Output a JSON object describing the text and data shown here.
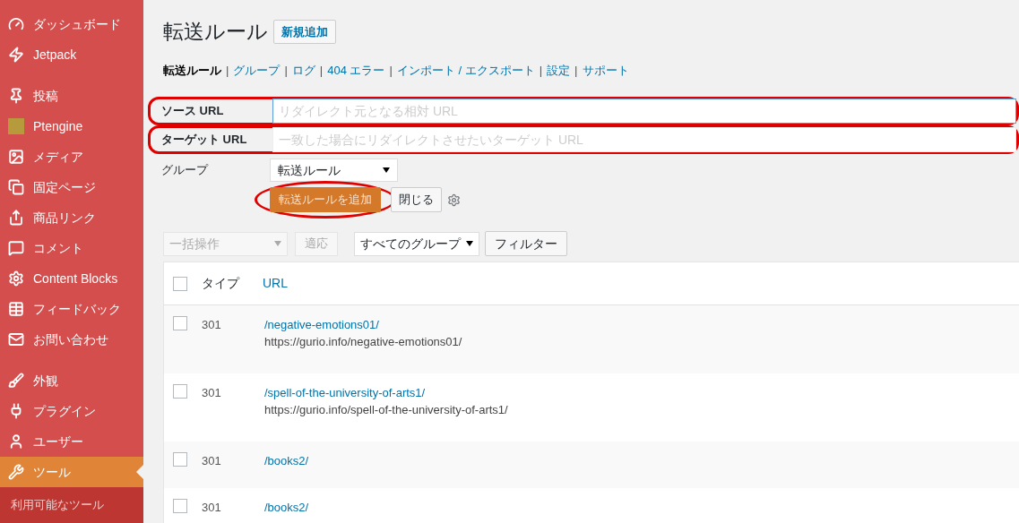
{
  "sidebar": {
    "groups": [
      [
        {
          "label": "ダッシュボード",
          "selected": false
        },
        {
          "label": "Jetpack",
          "selected": false
        }
      ],
      [
        {
          "label": "投稿",
          "selected": false
        },
        {
          "label": "Ptengine",
          "selected": false
        },
        {
          "label": "メディア",
          "selected": false
        },
        {
          "label": "固定ページ",
          "selected": false
        },
        {
          "label": "商品リンク",
          "selected": false
        },
        {
          "label": "コメント",
          "selected": false
        },
        {
          "label": "Content Blocks",
          "selected": false
        },
        {
          "label": "フィードバック",
          "selected": false
        },
        {
          "label": "お問い合わせ",
          "selected": false
        }
      ],
      [
        {
          "label": "外観",
          "selected": false
        },
        {
          "label": "プラグイン",
          "selected": false
        },
        {
          "label": "ユーザー",
          "selected": false
        },
        {
          "label": "ツール",
          "selected": true
        }
      ]
    ],
    "submenu": [
      {
        "label": "利用可能なツール",
        "selected": false
      }
    ]
  },
  "page": {
    "title": "転送ルール",
    "add_new": "新規追加"
  },
  "subnav": [
    {
      "label": "転送ルール",
      "selected": true
    },
    {
      "label": "グループ",
      "selected": false
    },
    {
      "label": "ログ",
      "selected": false
    },
    {
      "label": "404 エラー",
      "selected": false
    },
    {
      "label": "インポート / エクスポート",
      "selected": false
    },
    {
      "label": "設定",
      "selected": false
    },
    {
      "label": "サポート",
      "selected": false
    }
  ],
  "subnav_separator": "|",
  "form": {
    "fields": [
      {
        "label": "ソース URL",
        "placeholder": "リダイレクト元となる相対 URL",
        "highlighted": true
      },
      {
        "label": "ターゲット URL",
        "placeholder": "一致した場合にリダイレクトさせたいターゲット URL",
        "highlighted": true
      }
    ],
    "group": {
      "label": "グループ",
      "value": "転送ルール"
    },
    "submit": {
      "label": "転送ルールを追加",
      "highlighted": true
    },
    "close": "閉じる"
  },
  "toolbar": {
    "bulk": {
      "value": "一括操作",
      "disabled": true
    },
    "apply": {
      "label": "適応",
      "disabled": true
    },
    "group_filter": "すべてのグループ",
    "filter": "フィルター"
  },
  "table": {
    "select_all": false,
    "columns": [
      "タイプ",
      "URL"
    ],
    "rows": [
      {
        "checked": false,
        "type": "301",
        "source": "/negative-emotions01/",
        "target": "https://gurio.info/negative-emotions01/"
      },
      {
        "checked": false,
        "type": "301",
        "source": "/spell-of-the-university-of-arts1/",
        "target": "https://gurio.info/spell-of-the-university-of-arts1/"
      },
      {
        "checked": false,
        "type": "301",
        "source": "/books2/"
      },
      {
        "checked": false,
        "type": "301",
        "source": "/books2/"
      }
    ]
  }
}
